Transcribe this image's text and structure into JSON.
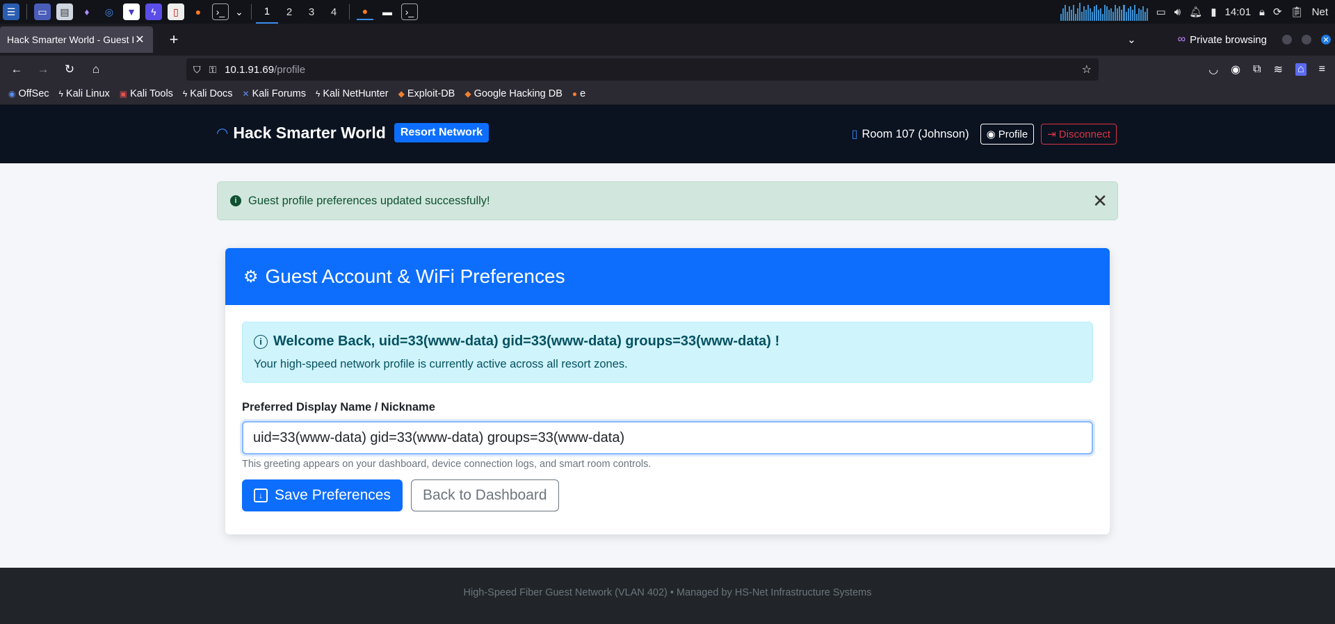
{
  "taskbar": {
    "workspaces": [
      "1",
      "2",
      "3",
      "4"
    ],
    "clock": "14:01",
    "network_label": "Net",
    "cpu_levels": [
      0.4,
      0.7,
      0.9,
      0.5,
      0.8,
      0.6,
      0.9,
      0.4,
      0.7,
      1.0,
      0.5,
      0.8,
      0.6,
      0.9,
      0.7,
      0.5,
      0.8,
      0.9,
      0.6,
      0.7,
      0.4,
      0.9,
      0.8,
      0.6,
      0.7,
      0.5,
      0.9,
      0.7,
      0.8,
      0.6,
      0.9,
      0.5,
      0.7,
      0.8,
      0.6,
      0.9,
      0.4,
      0.7,
      0.6,
      0.8,
      0.5,
      0.7
    ]
  },
  "browser": {
    "tab_title": "Hack Smarter World - Guest Po",
    "private_label": "Private browsing",
    "url_host": "10.1.91.69",
    "url_path": "/profile",
    "bookmarks": [
      "OffSec",
      "Kali Linux",
      "Kali Tools",
      "Kali Docs",
      "Kali Forums",
      "Kali NetHunter",
      "Exploit-DB",
      "Google Hacking DB",
      "e"
    ]
  },
  "header": {
    "brand": "Hack Smarter World",
    "badge": "Resort Network",
    "room": "Room 107 (Johnson)",
    "profile_btn": "Profile",
    "disconnect_btn": "Disconnect"
  },
  "alert": {
    "message": "Guest profile preferences updated successfully!"
  },
  "card": {
    "title": "Guest Account & WiFi Preferences",
    "welcome": "Welcome Back, uid=33(www-data) gid=33(www-data) groups=33(www-data) !",
    "welcome_sub": "Your high-speed network profile is currently active across all resort zones.",
    "field_label": "Preferred Display Name / Nickname",
    "field_value": "uid=33(www-data) gid=33(www-data) groups=33(www-data)",
    "help": "This greeting appears on your dashboard, device connection logs, and smart room controls.",
    "save_btn": "Save Preferences",
    "back_btn": "Back to Dashboard"
  },
  "footer": {
    "text": "High-Speed Fiber Guest Network (VLAN 402) • Managed by HS-Net Infrastructure Systems"
  },
  "colors": {
    "primary": "#0d6efd",
    "header_bg": "#0b1220",
    "success_bg": "#d1e7dd",
    "info_bg": "#cff4fc",
    "danger": "#dc3545"
  }
}
